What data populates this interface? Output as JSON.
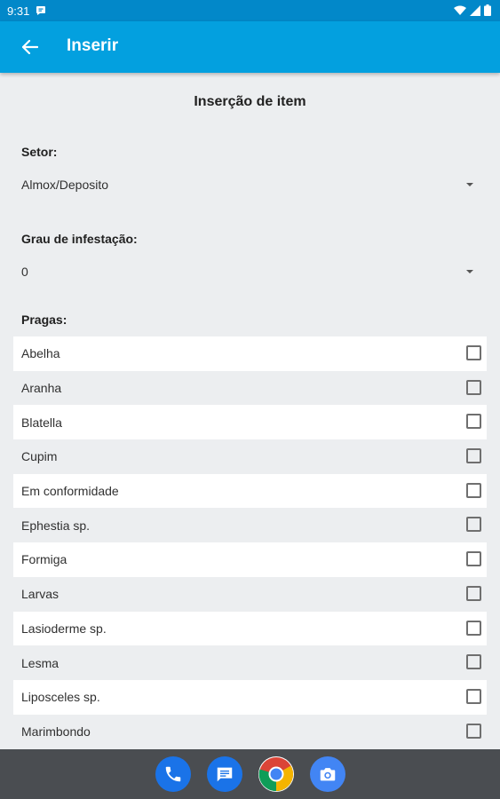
{
  "status": {
    "time": "9:31"
  },
  "app_bar": {
    "title": "Inserir"
  },
  "form": {
    "title": "Inserção de item",
    "setor_label": "Setor:",
    "setor_value": "Almox/Deposito",
    "grau_label": "Grau de infestação:",
    "grau_value": "0",
    "pragas_label": "Pragas:"
  },
  "pests": [
    {
      "label": "Abelha",
      "checked": false
    },
    {
      "label": "Aranha",
      "checked": false
    },
    {
      "label": "Blatella",
      "checked": false
    },
    {
      "label": "Cupim",
      "checked": false
    },
    {
      "label": "Em conformidade",
      "checked": false
    },
    {
      "label": "Ephestia sp.",
      "checked": false
    },
    {
      "label": "Formiga",
      "checked": false
    },
    {
      "label": "Larvas",
      "checked": false
    },
    {
      "label": "Lasioderme sp.",
      "checked": false
    },
    {
      "label": "Lesma",
      "checked": false
    },
    {
      "label": "Liposceles sp.",
      "checked": false
    },
    {
      "label": "Marimbondo",
      "checked": false
    }
  ],
  "dock": [
    {
      "name": "phone-app",
      "icon": "phone-icon",
      "color": "#1a73e8"
    },
    {
      "name": "messages-app",
      "icon": "messages-icon",
      "color": "#1a73e8"
    },
    {
      "name": "chrome-app",
      "icon": "chrome-icon",
      "color": "#ffffff"
    },
    {
      "name": "camera-app",
      "icon": "camera-icon",
      "color": "#4285f4"
    }
  ],
  "colors": {
    "app_bar": "#03a0df",
    "status_bar": "#0288c9",
    "background": "#eceef0"
  }
}
